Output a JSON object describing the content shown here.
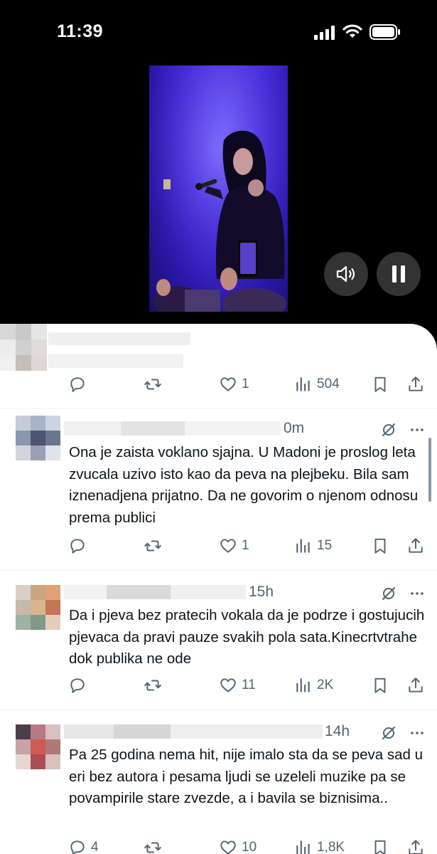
{
  "status_bar": {
    "time": "11:39"
  },
  "video": {
    "mute_icon": "speaker-icon",
    "pause_icon": "pause-icon"
  },
  "top_tweet": {
    "replies": "",
    "reposts": "",
    "likes": "1",
    "views": "504"
  },
  "replies": [
    {
      "time": "0m",
      "text": "Ona je zaista voklano sjajna. U Madoni je proslog leta zvucala uzivo isto kao da peva na plejbeku. Bila sam iznenadjena prijatno. Da ne govorim o njenom odnosu prema publici",
      "replies": "",
      "reposts": "",
      "likes": "1",
      "views": "15"
    },
    {
      "time": "15h",
      "text": "Da i pjeva bez pratecih vokala da je podrze i gostujucih pjevaca da pravi pauze svakih pola sata.Kinecrtvtrahe dok publika  ne ode",
      "replies": "",
      "reposts": "",
      "likes": "11",
      "views": "2K"
    },
    {
      "time": "14h",
      "text": "Pa 25 godina nema hit, nije imalo sta da se peva sad u eri bez autora i pesama ljudi se uzeleli muzike pa se povampirile stare zvezde, a i bavila se biznisima..",
      "replies": "4",
      "reposts": "",
      "likes": "10",
      "views": "1,8K"
    }
  ],
  "colors": {
    "text": "#0f1419",
    "secondary": "#536471",
    "divider": "#eff3f4"
  }
}
